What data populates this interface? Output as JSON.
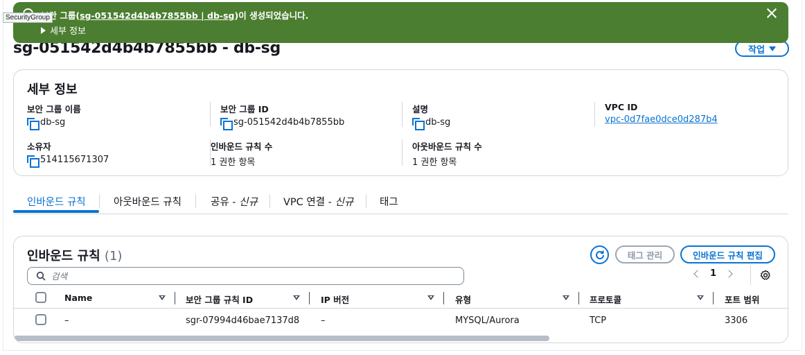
{
  "flash": {
    "message_prefix": "보안 그룹(",
    "message_link": "sg-051542d4b4b7855bb | db-sg",
    "message_suffix": ")이 생성되었습니다.",
    "details_label": "세부 정보",
    "type": "success",
    "color": "#4b7e30"
  },
  "tooltip": {
    "text": "SecurityGroup"
  },
  "page": {
    "title": "sg-051542d4b4b7855bb - db-sg",
    "action_button": "작업"
  },
  "details": {
    "title": "세부 정보",
    "fields": {
      "name": {
        "label": "보안 그룹 이름",
        "value": "db-sg"
      },
      "id": {
        "label": "보안 그룹 ID",
        "value": "sg-051542d4b4b7855bb"
      },
      "description": {
        "label": "설명",
        "value": "db-sg"
      },
      "vpc": {
        "label": "VPC ID",
        "value": "vpc-0d7fae0dce0d287b4"
      },
      "owner": {
        "label": "소유자",
        "value": "514115671307"
      },
      "inbound_count": {
        "label": "인바운드 규칙 수",
        "value": "1 권한 항목"
      },
      "outbound_count": {
        "label": "아웃바운드 규칙 수",
        "value": "1 권한 항목"
      }
    }
  },
  "tabs": [
    {
      "label": "인바운드 규칙",
      "active": true
    },
    {
      "label": "아웃바운드 규칙"
    },
    {
      "label": "공유 - ",
      "tag": "신규"
    },
    {
      "label": "VPC 연결 - ",
      "tag": "신규"
    },
    {
      "label": "태그"
    }
  ],
  "rules": {
    "title": "인바운드 규칙",
    "count": "(1)",
    "manage_tags_button": "태그 관리",
    "edit_button": "인바운드 규칙 편집",
    "search_placeholder": "검색",
    "page_number": "1",
    "columns": [
      "Name",
      "보안 그룹 규칙 ID",
      "IP 버전",
      "유형",
      "프로토콜",
      "포트 범위"
    ],
    "rows": [
      {
        "name": "–",
        "rule_id": "sgr-07994d46bae7137d8",
        "ip_version": "–",
        "type": "MYSQL/Aurora",
        "protocol": "TCP",
        "port_range": "3306"
      }
    ]
  },
  "colors": {
    "accent": "#0972d3",
    "success": "#4b7e30",
    "text": "#16191f",
    "border": "#d1d5db"
  }
}
